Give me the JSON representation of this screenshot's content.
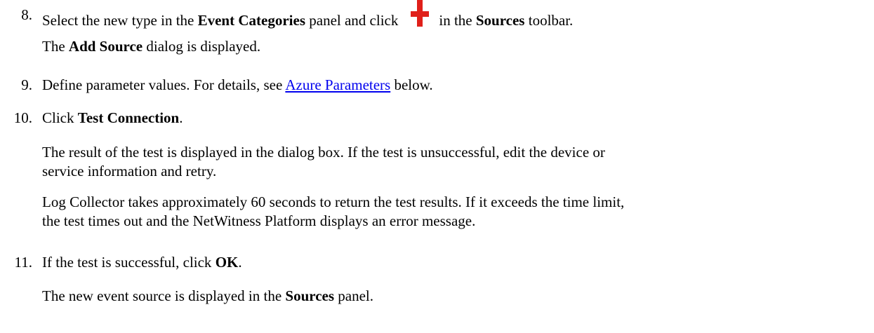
{
  "steps": [
    {
      "number": "8.",
      "parts": {
        "a": "Select the new type in the ",
        "b": "Event Categories",
        "c": " panel and click",
        "d": "in the ",
        "e": "Sources",
        "f": " toolbar."
      },
      "icon": "add-plus-icon",
      "result": {
        "a": "The ",
        "b": "Add Source",
        "c": " dialog is displayed."
      }
    },
    {
      "number": "9.",
      "parts": {
        "a": "Define parameter values. For details, see ",
        "link": "Azure Parameters",
        "c": " below."
      }
    },
    {
      "number": "10.",
      "parts": {
        "a": "Click ",
        "b": "Test Connection",
        "c": "."
      },
      "para1_line1": "The result of the test is displayed in the dialog box. If the test is unsuccessful, edit the device or",
      "para1_line2": "service information and retry.",
      "para2_line1": "Log Collector takes approximately 60 seconds to return the test results. If it exceeds the time limit,",
      "para2_line2": "the test times out and the NetWitness Platform displays an error message."
    },
    {
      "number": "11.",
      "parts": {
        "a": "If the test is successful, click ",
        "b": "OK",
        "c": "."
      },
      "result": {
        "a": "The new event source is displayed in the ",
        "b": "Sources",
        "c": " panel."
      }
    }
  ],
  "colors": {
    "link": "#0000ee",
    "icon": "#e0201a"
  }
}
